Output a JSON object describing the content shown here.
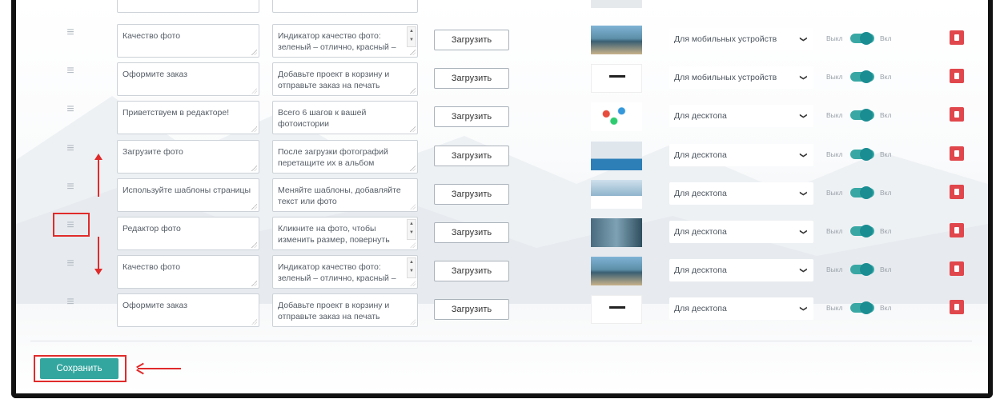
{
  "rows": [
    {
      "title": "Качество фото",
      "desc": "Индикатор качество фото: зеленый – отлично, красный –",
      "upload": "Загрузить",
      "device": "Для мобильных устройств",
      "off": "Выкл",
      "on": "Вкл"
    },
    {
      "title": "Оформите заказ",
      "desc": "Добавьте проект в корзину и отправьте заказ на печать",
      "upload": "Загрузить",
      "device": "Для мобильных устройств",
      "off": "Выкл",
      "on": "Вкл"
    },
    {
      "title": "Приветствуем в редакторе!",
      "desc": "Всего 6 шагов к вашей фотоистории",
      "upload": "Загрузить",
      "device": "Для десктопа",
      "off": "Выкл",
      "on": "Вкл"
    },
    {
      "title": "Загрузите фото",
      "desc": "После загрузки фотографий перетащите их в альбом",
      "upload": "Загрузить",
      "device": "Для десктопа",
      "off": "Выкл",
      "on": "Вкл"
    },
    {
      "title": "Используйте шаблоны страницы",
      "desc": "Меняйте шаблоны, добавляйте текст или фото",
      "upload": "Загрузить",
      "device": "Для десктопа",
      "off": "Выкл",
      "on": "Вкл"
    },
    {
      "title": "Редактор фото",
      "desc": "Кликните на фото, чтобы изменить размер, повернуть",
      "upload": "Загрузить",
      "device": "Для десктопа",
      "off": "Выкл",
      "on": "Вкл"
    },
    {
      "title": "Качество фото",
      "desc": "Индикатор качество фото: зеленый – отлично, красный –",
      "upload": "Загрузить",
      "device": "Для десктопа",
      "off": "Выкл",
      "on": "Вкл"
    },
    {
      "title": "Оформите заказ",
      "desc": "Добавьте проект в корзину и отправьте заказ на печать",
      "upload": "Загрузить",
      "device": "Для десктопа",
      "off": "Выкл",
      "on": "Вкл"
    }
  ],
  "save_label": "Сохранить",
  "icons": {
    "handle": "drag-handle-icon",
    "chevron": "chevron-down-icon",
    "delete": "trash-icon"
  },
  "colors": {
    "accent": "#33a69f",
    "toggle": "#1a8d92",
    "danger": "#e0474c",
    "annotation": "#e02b2b"
  }
}
